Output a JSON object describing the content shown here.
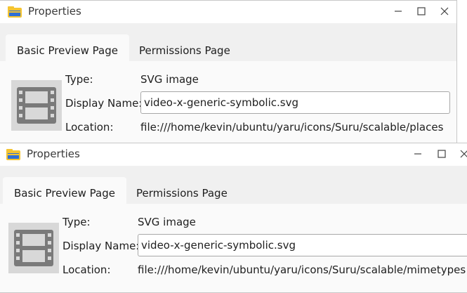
{
  "windows": [
    {
      "title": "Properties",
      "tabs": [
        {
          "label": "Basic Preview Page",
          "active": true
        },
        {
          "label": "Permissions Page",
          "active": false
        }
      ],
      "labels": {
        "type": "Type:",
        "display_name": "Display Name:",
        "location": "Location:"
      },
      "type_value": "SVG image",
      "display_name_value": "video-x-generic-symbolic.svg",
      "location_value": "file:///home/kevin/ubuntu/yaru/icons/Suru/scalable/places"
    },
    {
      "title": "Properties",
      "tabs": [
        {
          "label": "Basic Preview Page",
          "active": true
        },
        {
          "label": "Permissions Page",
          "active": false
        }
      ],
      "labels": {
        "type": "Type:",
        "display_name": "Display Name:",
        "location": "Location:"
      },
      "type_value": "SVG image",
      "display_name_value": "video-x-generic-symbolic.svg",
      "location_value": "file:///home/kevin/ubuntu/yaru/icons/Suru/scalable/mimetypes"
    }
  ],
  "icons": {
    "app": "folder-icon",
    "preview": "video-film-icon",
    "minimize": "minimize-icon",
    "maximize": "maximize-icon",
    "close": "close-icon"
  },
  "colors": {
    "window_bg": "#f0f0f0",
    "content_bg": "#fafafa",
    "folder_yellow": "#f4c431",
    "folder_blue": "#2f6fd6",
    "film_gray": "#7a7a7a"
  }
}
